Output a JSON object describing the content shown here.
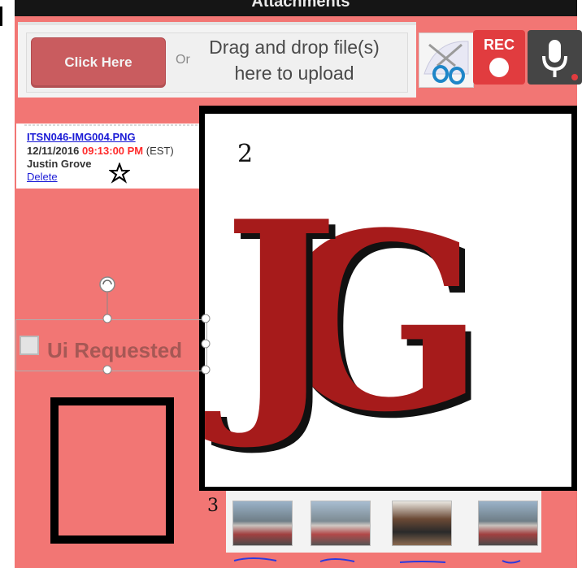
{
  "header": {
    "title": "Attachments"
  },
  "upload": {
    "button_label": "Click Here",
    "or_label": "Or",
    "drag_line1": "Drag and drop file(s)",
    "drag_line2": "here to upload"
  },
  "tools": {
    "rec_label": "REC"
  },
  "file": {
    "name": "ITSN046-IMG004.PNG",
    "date": "12/11/2016",
    "time": "09:13:00 PM",
    "timezone": "(EST)",
    "author": "Justin Grove",
    "delete_label": "Delete"
  },
  "checkbox": {
    "label": "Ui Requested",
    "checked": false
  },
  "annotations": {
    "number_2": "2",
    "number_3": "3"
  },
  "logo": {
    "text": "JG",
    "colors": {
      "primary": "#a61b1b",
      "shadow": "#111111"
    }
  },
  "colors": {
    "panel_bg": "#f27674",
    "rec_red": "#e13c3f",
    "mic_dark": "#454545",
    "link_blue": "#1b1bd6",
    "time_red": "#ff2b2b"
  }
}
